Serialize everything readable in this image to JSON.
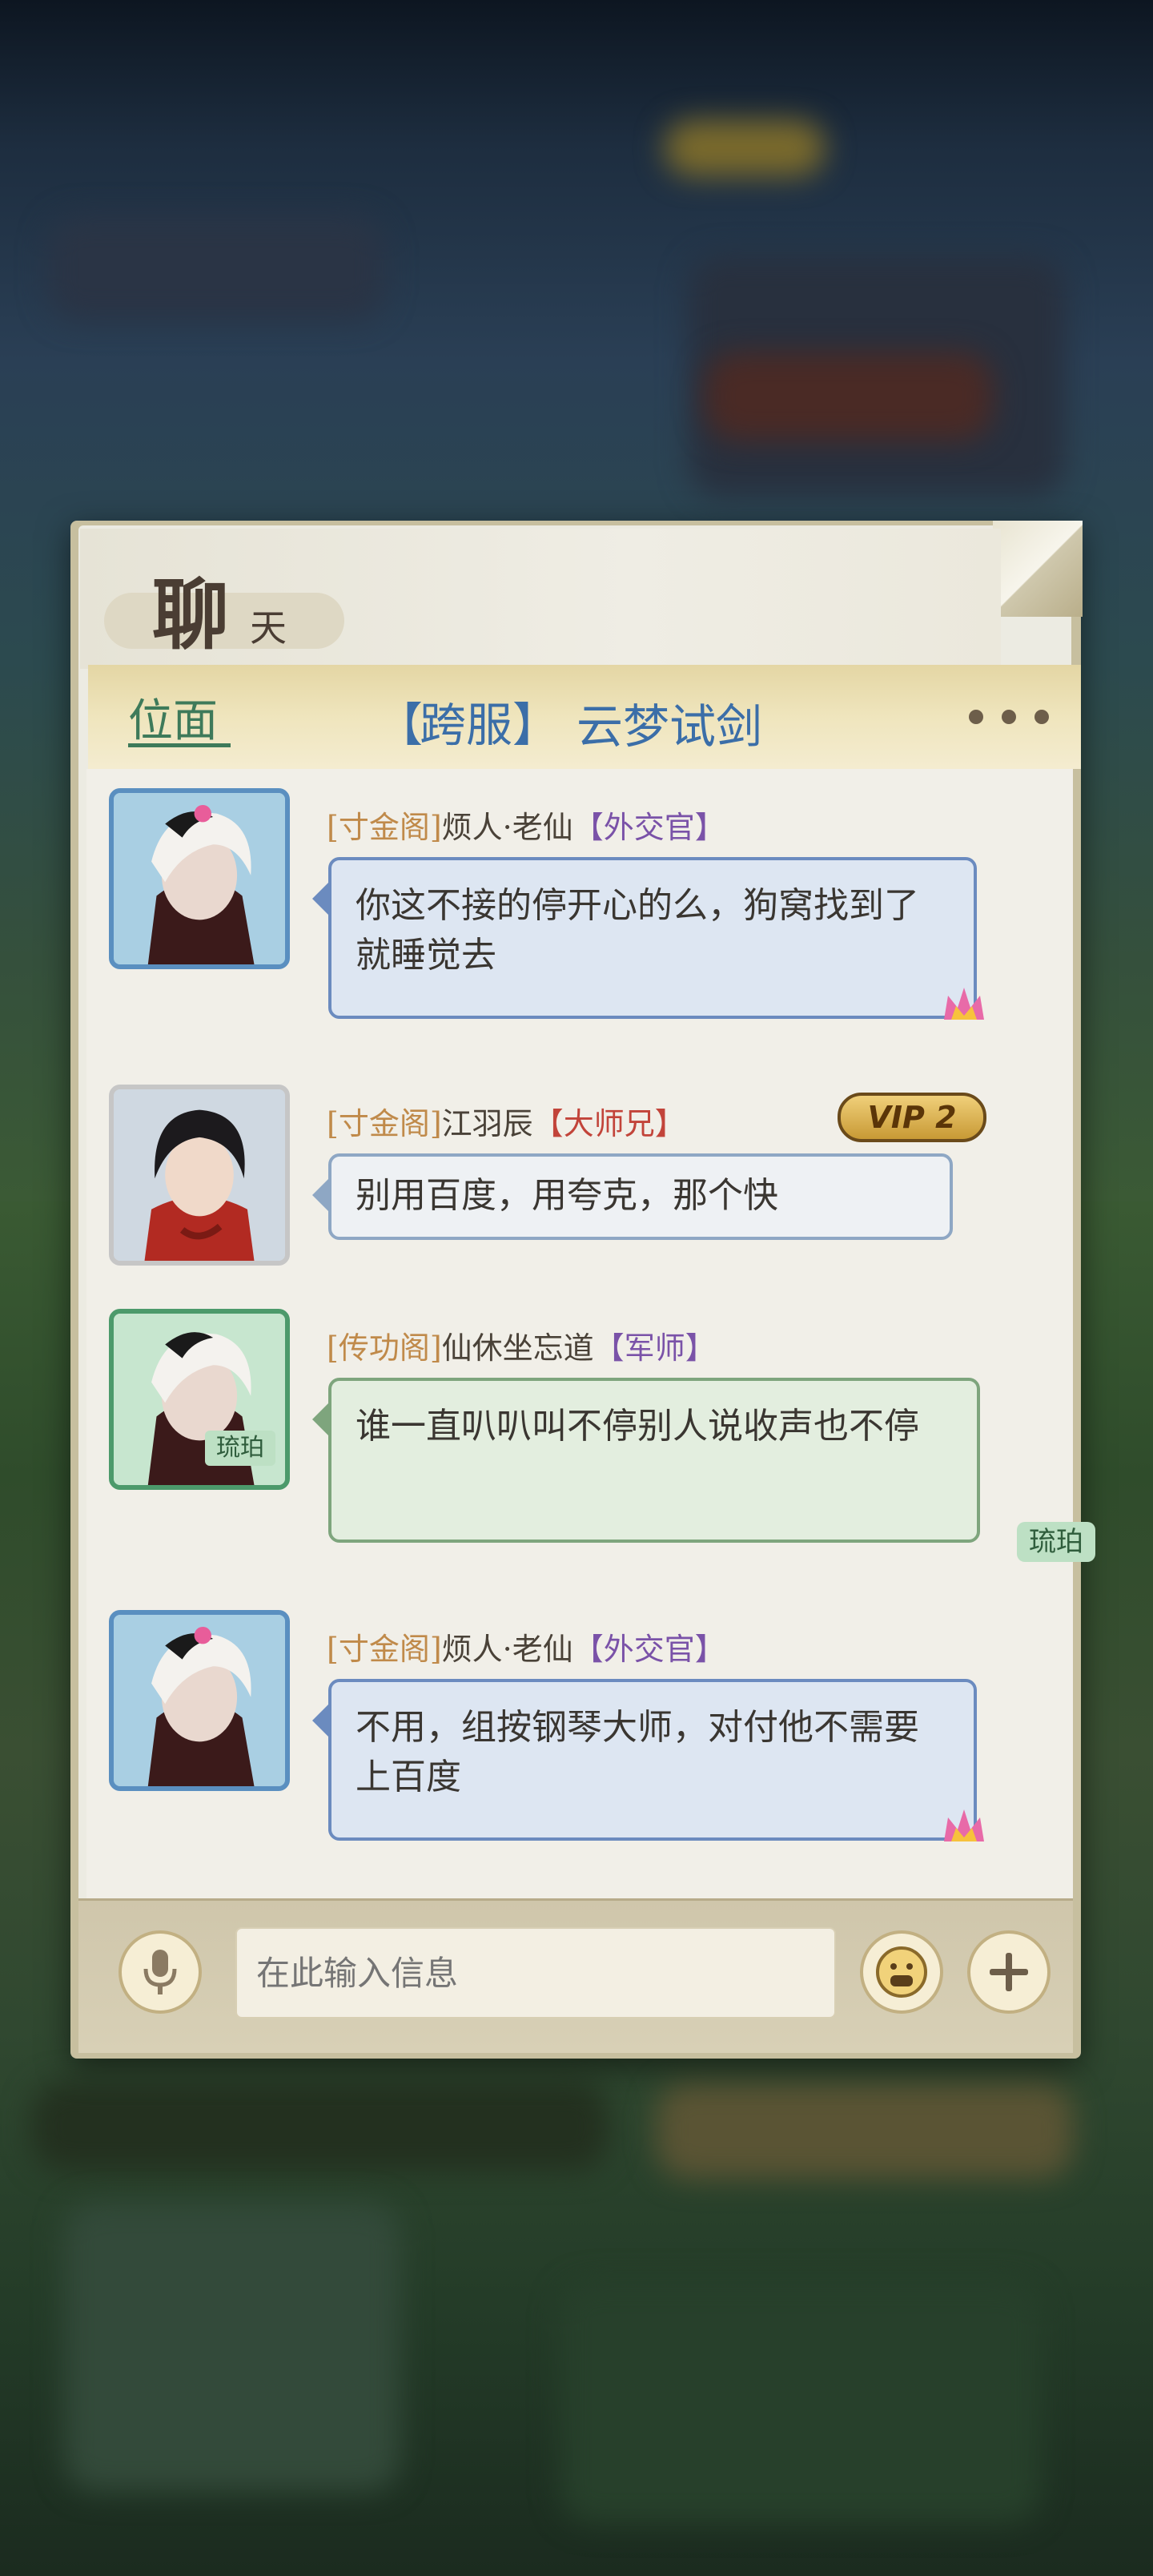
{
  "title": {
    "main": "聊",
    "sub": "天"
  },
  "tabs": {
    "channel": "位面",
    "server_open": "【",
    "server_tag": "跨服",
    "server_close": "】",
    "server_name": "云梦试剑"
  },
  "messages": [
    {
      "guild": "[寸金阁]",
      "name": "烦人·老仙",
      "role_open": "【",
      "role": "外交官",
      "role_close": "】",
      "text": "你这不接的停开心的么，狗窝找到了就睡觉去"
    },
    {
      "guild": "[寸金阁]",
      "name": "江羽辰",
      "role_open": "【",
      "role": "大师兄",
      "role_close": "】",
      "vip": "VIP 2",
      "text": "别用百度，用夸克，那个快"
    },
    {
      "guild": "[传功阁]",
      "name": "仙休坐忘道",
      "role_open": "【",
      "role": "军师",
      "role_close": "】",
      "text": "谁一直叭叭叫不停别人说收声也不停",
      "badge": "琉珀",
      "avatar_badge": "琉珀"
    },
    {
      "guild": "[寸金阁]",
      "name": "烦人·老仙",
      "role_open": "【",
      "role": "外交官",
      "role_close": "】",
      "text": "不用，组按钢琴大师，对付他不需要上百度"
    }
  ],
  "input": {
    "placeholder": "在此输入信息"
  },
  "icons": {
    "voice": "microphone-icon",
    "emoji": "emoji-face-icon",
    "add": "plus-icon",
    "more": "more-dots-icon"
  },
  "colors": {
    "channel_tab": "#3e7a5a",
    "server_tab": "#3b6ea8",
    "guild": "#c08a4a",
    "role_purple": "#7a52a8",
    "role_red": "#c2443a"
  }
}
